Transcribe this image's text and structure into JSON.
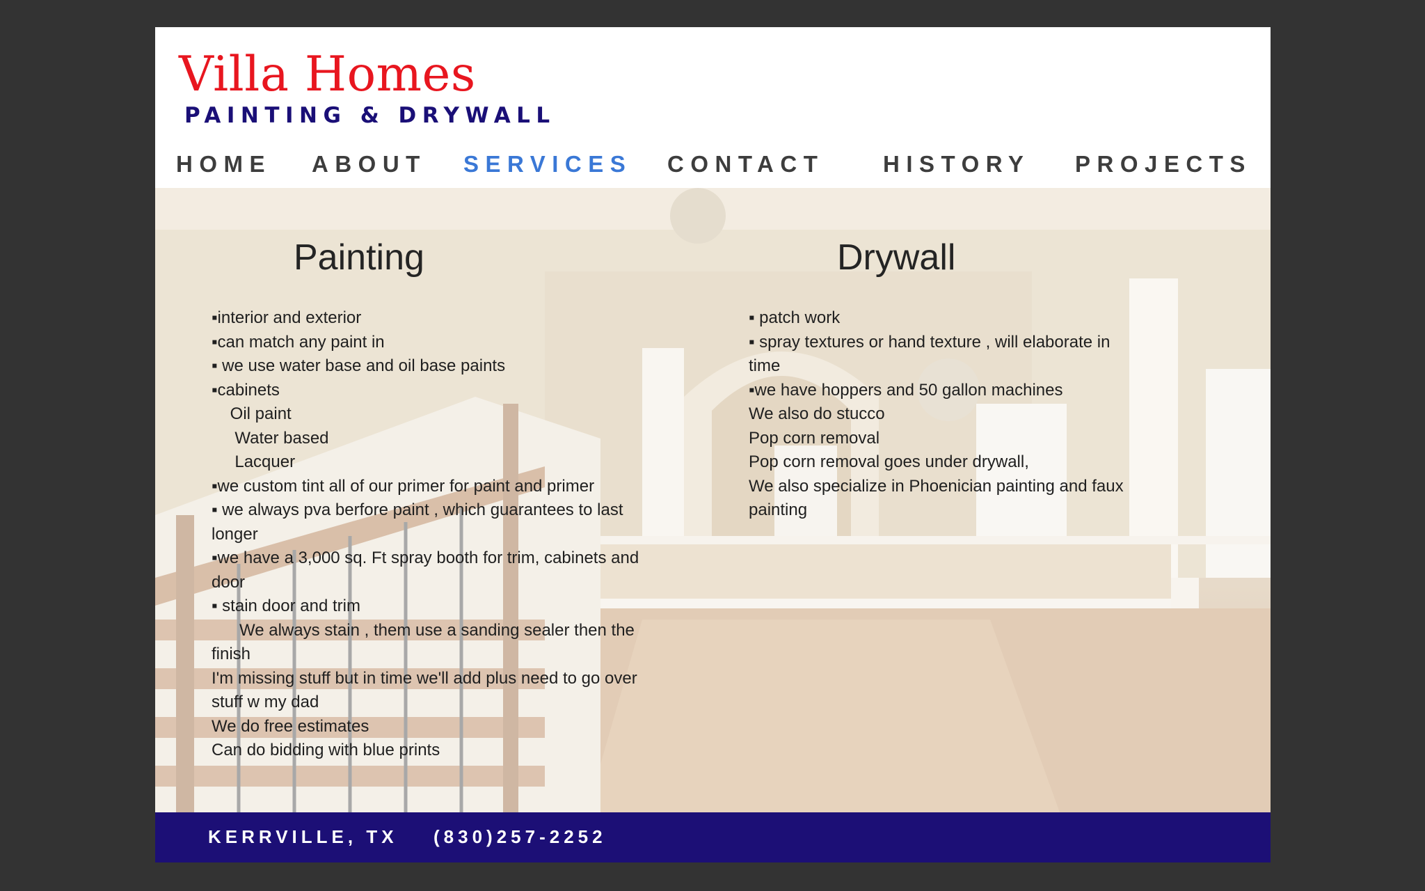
{
  "brand": {
    "title": "Villa Homes",
    "subtitle": "PAINTING & DRYWALL"
  },
  "nav": {
    "items": [
      {
        "label": "HOME"
      },
      {
        "label": "ABOUT"
      },
      {
        "label": "SERVICES",
        "active": true
      },
      {
        "label": "CONTACT"
      },
      {
        "label": "HISTORY"
      },
      {
        "label": "PROJECTS"
      }
    ],
    "active_color": "#3a78d6",
    "text_color": "#3d3d3d"
  },
  "painting": {
    "heading": "Painting",
    "lines": [
      "▪interior and exterior",
      "▪can match any paint in",
      "▪ we use water base and oil base paints",
      "▪cabinets",
      "    Oil paint",
      "     Water based",
      "     Lacquer",
      "▪we custom tint all of our primer for paint and primer",
      "▪ we always pva berfore paint , which guarantees to last",
      "longer",
      "▪we have a 3,000 sq. Ft spray booth for trim, cabinets and",
      "door",
      "▪ stain door and trim",
      "      We always stain , them use a sanding sealer then the",
      "finish",
      "I'm missing stuff but in time we'll add plus need to go over",
      "stuff w my dad",
      "We do free estimates",
      "Can do bidding with blue prints"
    ]
  },
  "drywall": {
    "heading": "Drywall",
    "lines": [
      "▪ patch work",
      "▪ spray textures or hand texture , will elaborate in",
      "time",
      "▪we have hoppers and 50 gallon machines",
      "We also do stucco",
      "Pop corn removal",
      "Pop corn removal goes under drywall,",
      "We also specialize in Phoenician painting and faux",
      "painting"
    ]
  },
  "footer": {
    "location": "KERRVILLE, TX",
    "phone": "(830)257-2252"
  },
  "colors": {
    "page_background": "#333333",
    "brand_red": "#e8161f",
    "brand_navy": "#1a0f77",
    "footer_navy": "#1c0f76"
  },
  "icons": {
    "hero_image": "house-interior-staircase-image"
  }
}
